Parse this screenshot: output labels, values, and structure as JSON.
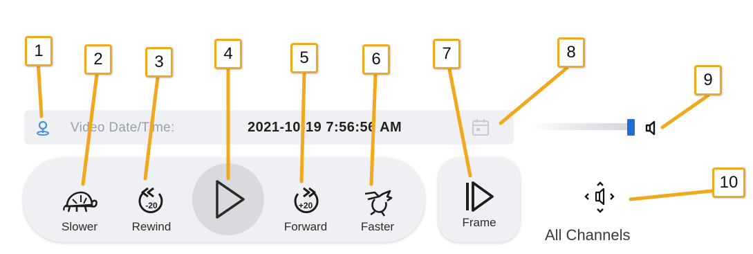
{
  "datetime": {
    "label": "Video Date/Time:",
    "value": "2021-10-19 7:56:56 AM"
  },
  "volume": {
    "level": 0.95
  },
  "controls": {
    "slower": {
      "label": "Slower",
      "icon": "turtle-icon"
    },
    "rewind": {
      "label": "Rewind",
      "icon": "rewind-20-icon",
      "seconds": "-20"
    },
    "play": {
      "icon": "play-icon"
    },
    "forward": {
      "label": "Forward",
      "icon": "forward-20-icon",
      "seconds": "+20"
    },
    "faster": {
      "label": "Faster",
      "icon": "rabbit-icon"
    }
  },
  "frame": {
    "label": "Frame",
    "icon": "frame-step-icon"
  },
  "channels": {
    "label": "All Channels",
    "icon": "all-channels-icon"
  },
  "callouts": [
    "1",
    "2",
    "3",
    "4",
    "5",
    "6",
    "7",
    "8",
    "9",
    "10"
  ],
  "colors": {
    "callout_border": "#f2a81d",
    "callout_line": "#f2a81d",
    "accent": "#1f6fd6",
    "pin_icon": "#4a8fd8"
  }
}
